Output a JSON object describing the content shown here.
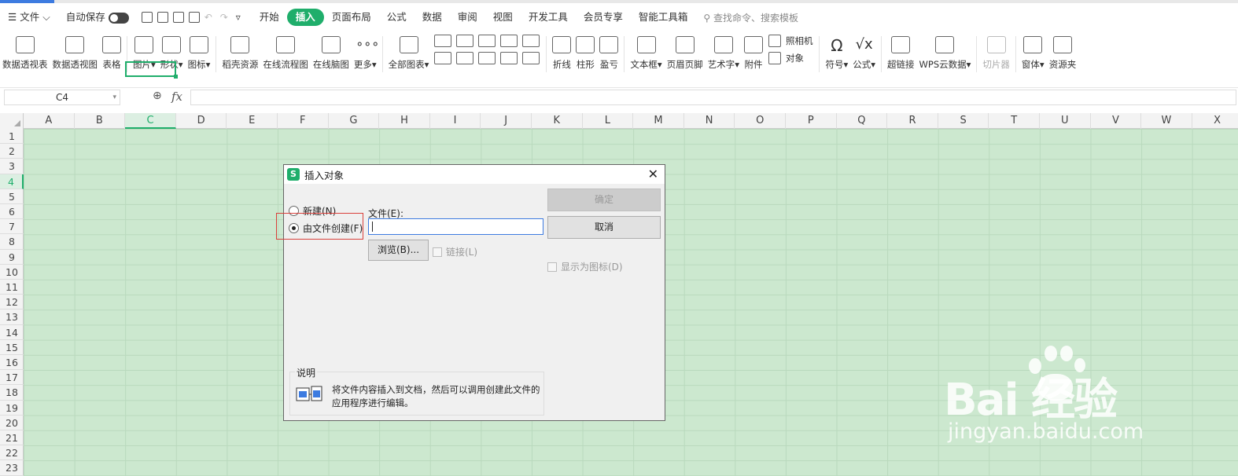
{
  "menu": {
    "file": "文件",
    "autosave": "自动保存",
    "tabs": [
      "开始",
      "插入",
      "页面布局",
      "公式",
      "数据",
      "审阅",
      "视图",
      "开发工具",
      "会员专享",
      "智能工具箱"
    ],
    "active_tab": "插入",
    "search_placeholder": "查找命令、搜索模板"
  },
  "ribbon": {
    "pivot_table": "数据透视表",
    "pivot_chart": "数据透视图",
    "table": "表格",
    "picture": "图片",
    "shape": "形状",
    "icon": "图标",
    "docer": "稻壳资源",
    "flowchart": "在线流程图",
    "mindmap": "在线脑图",
    "more": "更多",
    "all_charts": "全部图表",
    "line": "折线",
    "column": "柱形",
    "winloss": "盈亏",
    "textbox": "文本框",
    "header_footer": "页眉页脚",
    "wordart": "艺术字",
    "attachment": "附件",
    "camera": "照相机",
    "object": "对象",
    "symbol": "符号",
    "formula": "公式",
    "hyperlink": "超链接",
    "wps_cloud": "WPS云数据",
    "slicer": "切片器",
    "window": "窗体",
    "resource": "资源夹"
  },
  "formula_bar": {
    "name_box": "C4",
    "fx": "fx",
    "value": ""
  },
  "grid": {
    "columns": [
      "A",
      "B",
      "C",
      "D",
      "E",
      "F",
      "G",
      "H",
      "I",
      "J",
      "K",
      "L",
      "M",
      "N",
      "O",
      "P",
      "Q",
      "R",
      "S",
      "T",
      "U",
      "V",
      "W",
      "X"
    ],
    "rows": [
      "1",
      "2",
      "3",
      "4",
      "5",
      "6",
      "7",
      "8",
      "9",
      "10",
      "11",
      "12",
      "13",
      "14",
      "15",
      "16",
      "17",
      "18",
      "19",
      "20",
      "21",
      "22",
      "23"
    ],
    "selected_column": "C",
    "selected_row": "4",
    "background_color": "#cce8cf",
    "accent_color": "#1fae6b"
  },
  "dialog": {
    "title": "插入对象",
    "close": "✕",
    "new_option": "新建(N)",
    "from_file_option": "由文件创建(F)",
    "file_label": "文件(E):",
    "file_value": "",
    "browse": "浏览(B)...",
    "link": "链接(L)",
    "ok": "确定",
    "cancel": "取消",
    "show_as_icon": "显示为图标(D)",
    "desc_caption": "说明",
    "desc_text": "将文件内容插入到文档，然后可以调用创建此文件的应用程序进行编辑。"
  },
  "watermark": {
    "brand": "Bai  经验",
    "url": "jingyan.baidu.com"
  }
}
